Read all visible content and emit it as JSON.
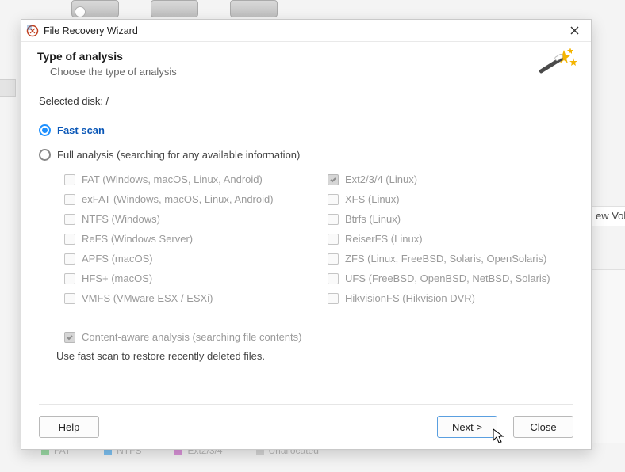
{
  "background": {
    "right_label": "ew Vol",
    "legend": {
      "fat": "FAT",
      "ntfs": "NTFS",
      "ext": "Ext2/3/4",
      "unalloc": "Unallocated"
    }
  },
  "dialog": {
    "title": "File Recovery Wizard",
    "heading": "Type of analysis",
    "subheading": "Choose the type of analysis",
    "selected_disk_label": "Selected disk: /",
    "scan_mode": "fast",
    "fast_label": "Fast scan",
    "full_label": "Full analysis (searching for any available information)",
    "fs_left": [
      {
        "label": "FAT (Windows, macOS, Linux, Android)",
        "checked": false
      },
      {
        "label": "exFAT (Windows, macOS, Linux, Android)",
        "checked": false
      },
      {
        "label": "NTFS (Windows)",
        "checked": false
      },
      {
        "label": "ReFS (Windows Server)",
        "checked": false
      },
      {
        "label": "APFS (macOS)",
        "checked": false
      },
      {
        "label": "HFS+ (macOS)",
        "checked": false
      },
      {
        "label": "VMFS (VMware ESX / ESXi)",
        "checked": false
      }
    ],
    "fs_right": [
      {
        "label": "Ext2/3/4 (Linux)",
        "checked": true
      },
      {
        "label": "XFS (Linux)",
        "checked": false
      },
      {
        "label": "Btrfs (Linux)",
        "checked": false
      },
      {
        "label": "ReiserFS (Linux)",
        "checked": false
      },
      {
        "label": "ZFS (Linux, FreeBSD, Solaris, OpenSolaris)",
        "checked": false
      },
      {
        "label": "UFS (FreeBSD, OpenBSD, NetBSD, Solaris)",
        "checked": false
      },
      {
        "label": "HikvisionFS (Hikvision DVR)",
        "checked": false
      }
    ],
    "content_aware": {
      "label": "Content-aware analysis (searching file contents)",
      "checked": true
    },
    "hint": "Use fast scan to restore recently deleted files.",
    "buttons": {
      "help": "Help",
      "next": "Next >",
      "close": "Close"
    }
  }
}
